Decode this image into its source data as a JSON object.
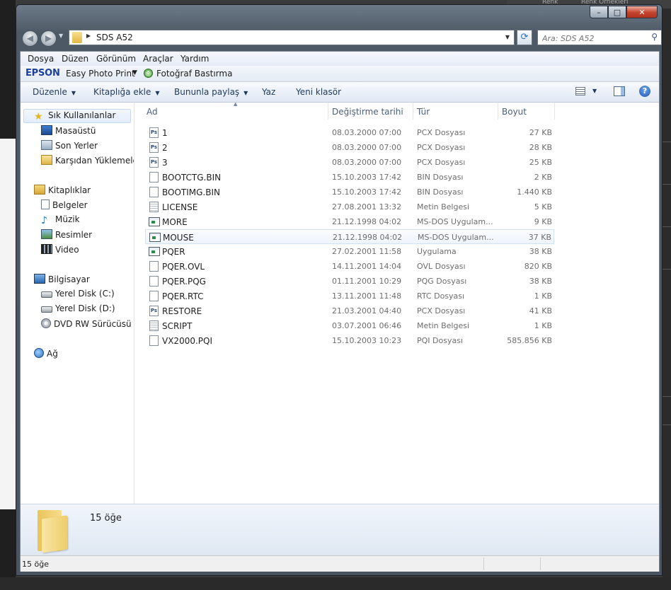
{
  "background": {
    "top_right_labels": [
      "Renk",
      "Renk Örnekleri"
    ]
  },
  "window": {
    "caption": {
      "minimize_glyph": "–",
      "maximize_glyph": "□",
      "close_glyph": "✕"
    },
    "address": {
      "path": "SDS A52"
    },
    "search": {
      "placeholder": "Ara: SDS A52"
    },
    "menu": [
      "Dosya",
      "Düzen",
      "Görünüm",
      "Araçlar",
      "Yardım"
    ],
    "epson": {
      "logo": "EPSON",
      "app": "Easy Photo Print",
      "print": "Fotoğraf Bastırma"
    },
    "commands": [
      "Düzenle",
      "Kitaplığa ekle",
      "Bununla paylaş",
      "Yaz",
      "Yeni klasör"
    ],
    "help_glyph": "?"
  },
  "navigation": {
    "favorites": {
      "label": "Sık Kullanılanlar",
      "icon": "star-icon",
      "items": [
        {
          "label": "Masaüstü",
          "icon": "desktop-icon"
        },
        {
          "label": "Son Yerler",
          "icon": "recent-places-icon"
        },
        {
          "label": "Karşıdan Yüklemeler",
          "icon": "downloads-icon"
        }
      ]
    },
    "libraries": {
      "label": "Kitaplıklar",
      "icon": "libraries-icon",
      "items": [
        {
          "label": "Belgeler",
          "icon": "documents-icon"
        },
        {
          "label": "Müzik",
          "icon": "music-icon"
        },
        {
          "label": "Resimler",
          "icon": "pictures-icon"
        },
        {
          "label": "Video",
          "icon": "video-icon"
        }
      ]
    },
    "computer": {
      "label": "Bilgisayar",
      "icon": "computer-icon",
      "items": [
        {
          "label": "Yerel Disk (C:)",
          "icon": "disk-icon"
        },
        {
          "label": "Yerel Disk (D:)",
          "icon": "disk-icon"
        },
        {
          "label": "DVD RW Sürücüsü (E",
          "icon": "dvd-icon"
        }
      ]
    },
    "network": {
      "label": "Ağ",
      "icon": "network-icon"
    }
  },
  "columns": {
    "name": "Ad",
    "date": "Değiştirme tarihi",
    "type": "Tür",
    "size": "Boyut"
  },
  "files": [
    {
      "name": "1",
      "date": "08.03.2000 07:00",
      "type": "PCX Dosyası",
      "size": "27 KB",
      "icon": "ps"
    },
    {
      "name": "2",
      "date": "08.03.2000 07:00",
      "type": "PCX Dosyası",
      "size": "28 KB",
      "icon": "ps"
    },
    {
      "name": "3",
      "date": "08.03.2000 07:00",
      "type": "PCX Dosyası",
      "size": "25 KB",
      "icon": "ps"
    },
    {
      "name": "BOOTCTG.BIN",
      "date": "15.10.2003 17:42",
      "type": "BIN Dosyası",
      "size": "2 KB",
      "icon": "file"
    },
    {
      "name": "BOOTIMG.BIN",
      "date": "15.10.2003 17:42",
      "type": "BIN Dosyası",
      "size": "1.440 KB",
      "icon": "file"
    },
    {
      "name": "LICENSE",
      "date": "27.08.2001 13:32",
      "type": "Metin Belgesi",
      "size": "5 KB",
      "icon": "txt"
    },
    {
      "name": "MORE",
      "date": "21.12.1998 04:02",
      "type": "MS-DOS Uygulam...",
      "size": "9 KB",
      "icon": "app"
    },
    {
      "name": "MOUSE",
      "date": "21.12.1998 04:02",
      "type": "MS-DOS Uygulam...",
      "size": "37 KB",
      "icon": "app"
    },
    {
      "name": "PQER",
      "date": "27.02.2001 11:58",
      "type": "Uygulama",
      "size": "38 KB",
      "icon": "app"
    },
    {
      "name": "PQER.OVL",
      "date": "14.11.2001 14:04",
      "type": "OVL Dosyası",
      "size": "820 KB",
      "icon": "file"
    },
    {
      "name": "PQER.PQG",
      "date": "01.11.2001 10:29",
      "type": "PQG Dosyası",
      "size": "38 KB",
      "icon": "file"
    },
    {
      "name": "PQER.RTC",
      "date": "13.11.2001 11:48",
      "type": "RTC Dosyası",
      "size": "1 KB",
      "icon": "file"
    },
    {
      "name": "RESTORE",
      "date": "21.03.2001 04:40",
      "type": "PCX Dosyası",
      "size": "41 KB",
      "icon": "ps"
    },
    {
      "name": "SCRIPT",
      "date": "03.07.2001 06:46",
      "type": "Metin Belgesi",
      "size": "1 KB",
      "icon": "txt"
    },
    {
      "name": "VX2000.PQI",
      "date": "15.10.2003 10:23",
      "type": "PQI Dosyası",
      "size": "585.856 KB",
      "icon": "file"
    }
  ],
  "selected_file": "MOUSE",
  "details": {
    "count": "15 öğe"
  },
  "status": {
    "text": "15 öğe"
  }
}
